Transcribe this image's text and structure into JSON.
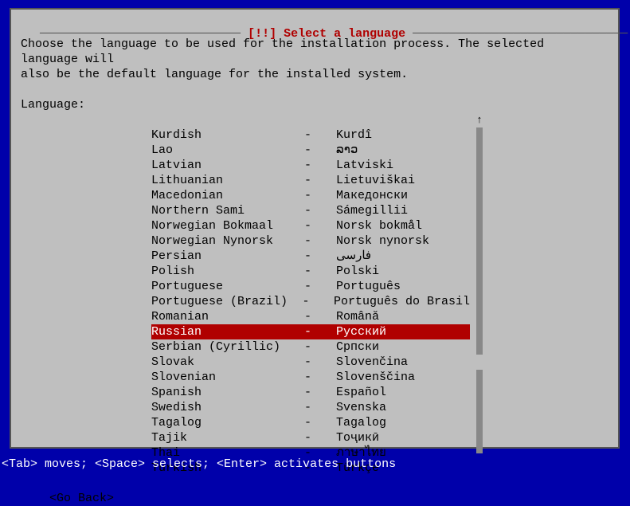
{
  "title": "[!!] Select a language",
  "instruction": "Choose the language to be used for the installation process. The selected language will\nalso be the default language for the installed system.",
  "label": "Language:",
  "languages": [
    {
      "name": "Kurdish",
      "sep": "-",
      "native": "Kurdî"
    },
    {
      "name": "Lao",
      "sep": "-",
      "native": "ລາວ"
    },
    {
      "name": "Latvian",
      "sep": "-",
      "native": "Latviski"
    },
    {
      "name": "Lithuanian",
      "sep": "-",
      "native": "Lietuviškai"
    },
    {
      "name": "Macedonian",
      "sep": "-",
      "native": "Македонски"
    },
    {
      "name": "Northern Sami",
      "sep": "-",
      "native": "Sámegillii"
    },
    {
      "name": "Norwegian Bokmaal",
      "sep": "-",
      "native": "Norsk bokmål"
    },
    {
      "name": "Norwegian Nynorsk",
      "sep": "-",
      "native": "Norsk nynorsk"
    },
    {
      "name": "Persian",
      "sep": "-",
      "native": "فارسی"
    },
    {
      "name": "Polish",
      "sep": "-",
      "native": "Polski"
    },
    {
      "name": "Portuguese",
      "sep": "-",
      "native": "Português"
    },
    {
      "name": "Portuguese (Brazil)",
      "sep": "-",
      "native": "Português do Brasil"
    },
    {
      "name": "Romanian",
      "sep": "-",
      "native": "Română"
    },
    {
      "name": "Russian",
      "sep": "-",
      "native": "Русский",
      "selected": true
    },
    {
      "name": "Serbian (Cyrillic)",
      "sep": "-",
      "native": "Српски"
    },
    {
      "name": "Slovak",
      "sep": "-",
      "native": "Slovenčina"
    },
    {
      "name": "Slovenian",
      "sep": "-",
      "native": "Slovenščina"
    },
    {
      "name": "Spanish",
      "sep": "-",
      "native": "Español"
    },
    {
      "name": "Swedish",
      "sep": "-",
      "native": "Svenska"
    },
    {
      "name": "Tagalog",
      "sep": "-",
      "native": "Tagalog"
    },
    {
      "name": "Tajik",
      "sep": "-",
      "native": "Тоҷикӣ"
    },
    {
      "name": "Thai",
      "sep": "-",
      "native": "ภาษาไทย"
    },
    {
      "name": "Turkish",
      "sep": "-",
      "native": "Türkçe"
    }
  ],
  "go_back": "<Go Back>",
  "helpbar": "<Tab> moves; <Space> selects; <Enter> activates buttons",
  "scroll_arrow_up": "↑"
}
